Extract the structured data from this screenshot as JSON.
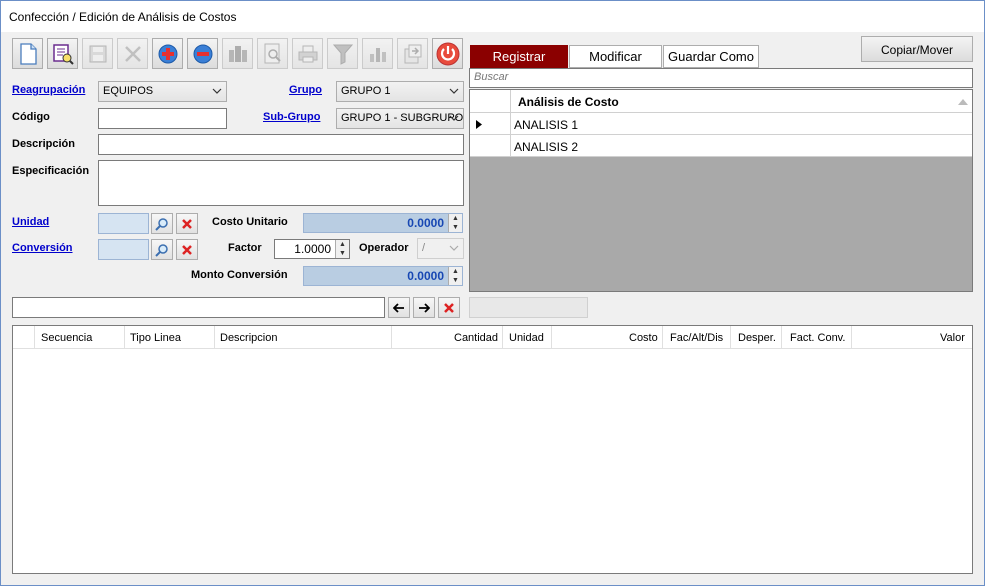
{
  "window": {
    "title": "Confección / Edición de Análisis de Costos"
  },
  "toolbar": {
    "buttons": [
      {
        "name": "new-icon"
      },
      {
        "name": "edit-search-icon"
      },
      {
        "name": "save-icon"
      },
      {
        "name": "delete-icon"
      },
      {
        "name": "add-icon"
      },
      {
        "name": "remove-icon"
      },
      {
        "name": "structure-icon"
      },
      {
        "name": "preview-icon"
      },
      {
        "name": "print-icon"
      },
      {
        "name": "filter-icon"
      },
      {
        "name": "chart-icon"
      },
      {
        "name": "export-icon"
      },
      {
        "name": "power-icon"
      }
    ]
  },
  "form": {
    "reagrupacion_label": "Reagrupación",
    "reagrupacion_value": "EQUIPOS",
    "grupo_label": "Grupo",
    "grupo_value": "GRUPO 1",
    "codigo_label": "Código",
    "codigo_value": "",
    "subgrupo_label": "Sub-Grupo",
    "subgrupo_value": "GRUPO 1 - SUBGRUPO",
    "descripcion_label": "Descripción",
    "especificacion_label": "Especificación",
    "unidad_label": "Unidad",
    "costo_unitario_label": "Costo Unitario",
    "costo_unitario_value": "0.0000",
    "conversion_label": "Conversión",
    "factor_label": "Factor",
    "factor_value": "1.0000",
    "operador_label": "Operador",
    "operador_value": "/",
    "monto_conversion_label": "Monto Conversión",
    "monto_conversion_value": "0.0000"
  },
  "right_panel": {
    "copiar_mover": "Copiar/Mover",
    "tabs": [
      "Registrar",
      "Modificar",
      "Guardar Como"
    ],
    "search_placeholder": "Buscar",
    "grid_header": "Análisis de Costo",
    "rows": [
      "ANALISIS 1",
      "ANALISIS 2"
    ]
  },
  "detail": {
    "columns": [
      "Secuencia",
      "Tipo Linea",
      "Descripcion",
      "Cantidad",
      "Unidad",
      "Costo",
      "Fac/Alt/Dis",
      "Desper.",
      "Fact. Conv.",
      "Valor"
    ]
  },
  "colors": {
    "accent_tab": "#8b0000",
    "link": "#0000cc",
    "value_blue": "#1747b3"
  }
}
